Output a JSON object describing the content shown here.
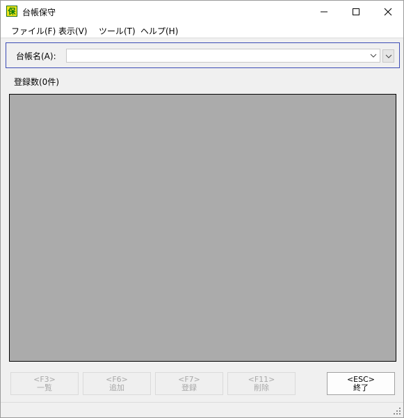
{
  "window": {
    "title": "台帳保守",
    "app_icon_glyph": "保",
    "icon_colors": {
      "bg": "#f2e61c",
      "fg": "#0a7a0a"
    }
  },
  "menu": {
    "file": "ファイル(F)",
    "view": "表示(V)",
    "tools": "ツール(T)",
    "help": "ヘルプ(H)"
  },
  "ledger": {
    "label": "台帳名(A):",
    "value": ""
  },
  "records": {
    "count_label": "登録数(0件)"
  },
  "function_keys": [
    {
      "key": "<F3>",
      "label": "一覧",
      "enabled": false
    },
    {
      "key": "<F6>",
      "label": "追加",
      "enabled": false
    },
    {
      "key": "<F7>",
      "label": "登録",
      "enabled": false
    },
    {
      "key": "<F11>",
      "label": "削除",
      "enabled": false
    },
    {
      "key": "<ESC>",
      "label": "終了",
      "enabled": true
    }
  ],
  "colors": {
    "grid_background": "#ababab",
    "panel_border": "#3b4bb5",
    "disabled_text": "#a8a8a8"
  }
}
